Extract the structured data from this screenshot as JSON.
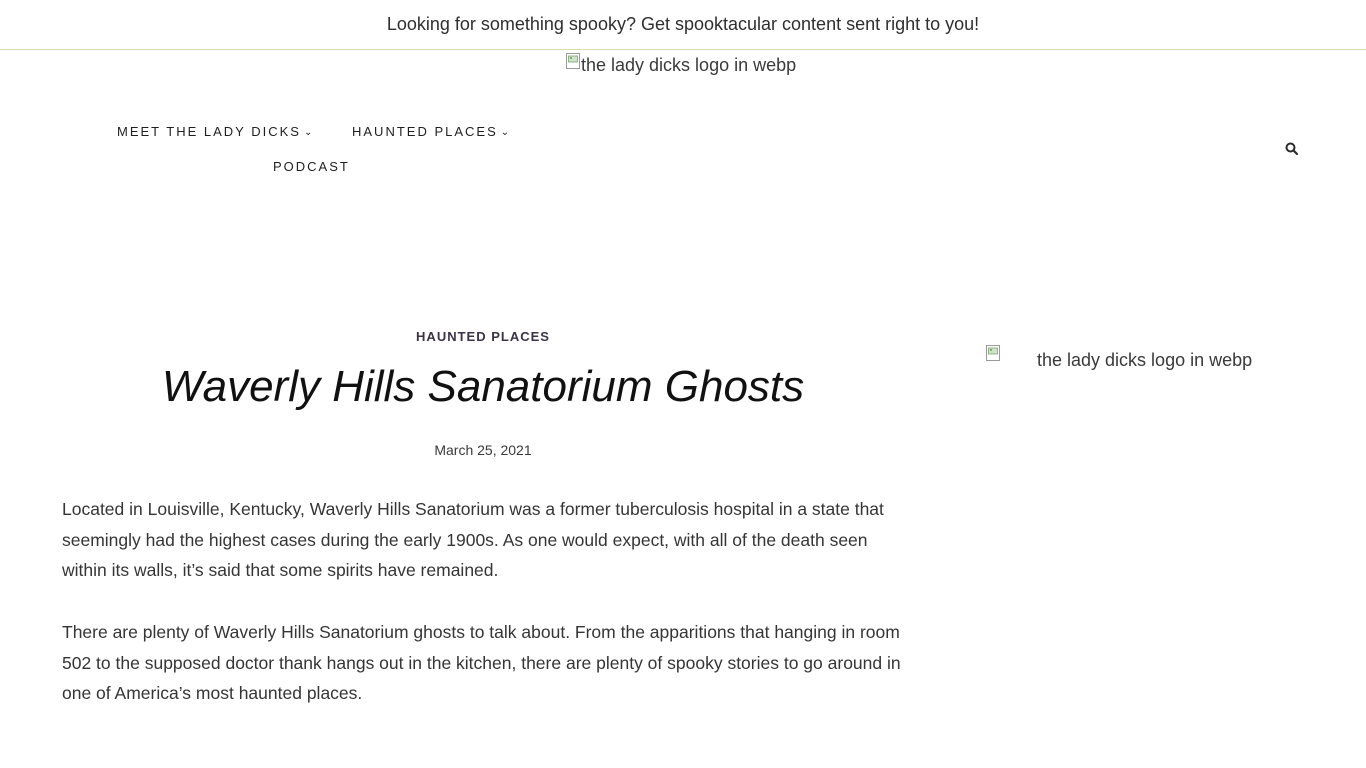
{
  "announcement": {
    "text": "Looking for something spooky? Get spooktacular content sent right to you!"
  },
  "header": {
    "logo_alt": "the lady dicks logo in webp"
  },
  "nav": {
    "items": [
      {
        "label": "MEET THE LADY DICKS",
        "has_dropdown": true
      },
      {
        "label": "HAUNTED PLACES",
        "has_dropdown": true
      },
      {
        "label": "PODCAST",
        "has_dropdown": false
      }
    ],
    "dropdown_icon": "chevron-down-icon",
    "search_icon": "search-icon"
  },
  "post": {
    "category": "HAUNTED PLACES",
    "title": "Waverly Hills Sanatorium Ghosts",
    "date": "March 25, 2021",
    "paragraphs": [
      "Located in Louisville, Kentucky, Waverly Hills Sanatorium was a former tuberculosis hospital in a state that seemingly had the highest cases during the early 1900s. As one would expect, with all of the death seen within its walls, it’s said that some spirits have remained.",
      "There are plenty of Waverly Hills Sanatorium ghosts to talk about. From the apparitions that hanging in room 502 to the supposed doctor thank hangs out in the kitchen, there are plenty of spooky stories to go around in one of America’s most haunted places."
    ]
  },
  "sidebar": {
    "image_alt": "the lady dicks logo in webp"
  },
  "colors": {
    "topbar_border": "#d9dcb0",
    "category": "#3b3348",
    "title": "#111111",
    "body_text": "#353535"
  }
}
